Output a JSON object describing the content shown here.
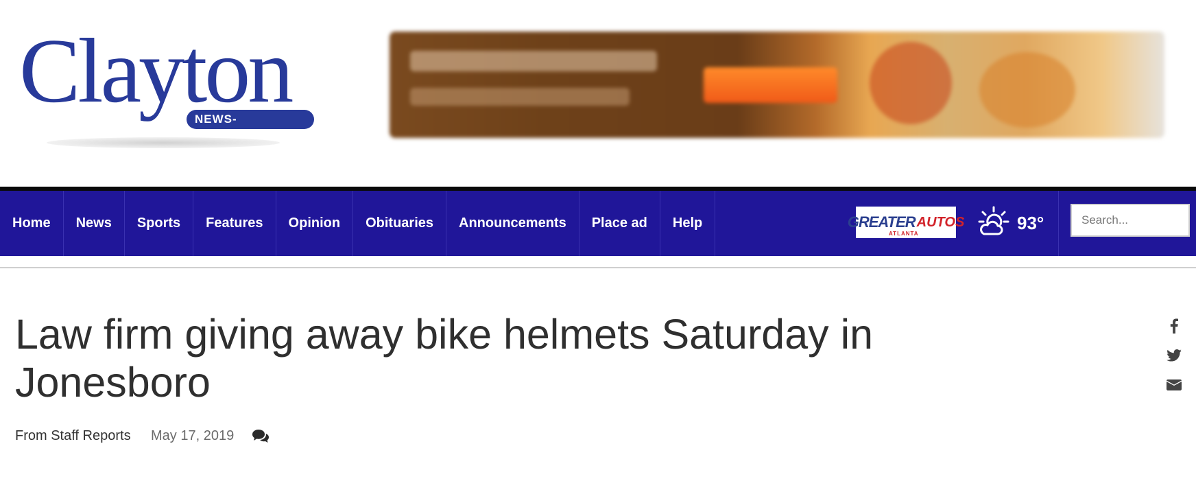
{
  "header": {
    "logo_word": "Clayton",
    "logo_sub": "NEWS-DAILY.COM",
    "brand_color": "#283a9a"
  },
  "nav": {
    "background": "#201699",
    "items": [
      {
        "label": "Home"
      },
      {
        "label": "News"
      },
      {
        "label": "Sports"
      },
      {
        "label": "Features"
      },
      {
        "label": "Opinion"
      },
      {
        "label": "Obituaries"
      },
      {
        "label": "Announcements"
      },
      {
        "label": "Place ad"
      },
      {
        "label": "Help"
      }
    ],
    "sponsor": {
      "word1": "GREATER",
      "word2": "AUTOS",
      "sub": "ATLANTA"
    },
    "weather": {
      "icon": "partly-sunny-icon",
      "temp": "93°"
    },
    "search": {
      "placeholder": "Search..."
    }
  },
  "article": {
    "headline": "Law firm giving away bike helmets Saturday in Jonesboro",
    "byline": "From Staff Reports",
    "date": "May 17, 2019",
    "comment_icon": "comments-icon"
  },
  "share": {
    "icons": [
      "facebook-icon",
      "twitter-icon",
      "envelope-icon"
    ]
  }
}
